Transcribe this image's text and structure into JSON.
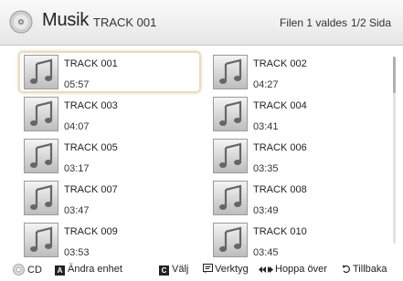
{
  "header": {
    "title": "Musik",
    "current_track": "TRACK 001",
    "selection_status": "Filen 1 valdes",
    "page_status": "1/2 Sida"
  },
  "tracks": [
    {
      "name": "TRACK 001",
      "duration": "05:57",
      "selected": true
    },
    {
      "name": "TRACK 002",
      "duration": "04:27",
      "selected": false
    },
    {
      "name": "TRACK 003",
      "duration": "04:07",
      "selected": false
    },
    {
      "name": "TRACK 004",
      "duration": "03:41",
      "selected": false
    },
    {
      "name": "TRACK 005",
      "duration": "03:17",
      "selected": false
    },
    {
      "name": "TRACK 006",
      "duration": "03:35",
      "selected": false
    },
    {
      "name": "TRACK 007",
      "duration": "03:47",
      "selected": false
    },
    {
      "name": "TRACK 008",
      "duration": "03:49",
      "selected": false
    },
    {
      "name": "TRACK 009",
      "duration": "03:53",
      "selected": false
    },
    {
      "name": "TRACK 010",
      "duration": "03:45",
      "selected": false
    }
  ],
  "footer": {
    "cd_label": "CD",
    "change_device_key": "A",
    "change_device_label": "Ändra enhet",
    "select_key": "C",
    "select_label": "Välj",
    "tools_label": "Verktyg",
    "skip_label": "Hoppa över",
    "back_label": "Tillbaka"
  },
  "icons": {
    "header": "disc-icon",
    "tile": "music-note-icon",
    "cd": "dpad-icon",
    "tools": "tools-icon",
    "skip": "skip-icon",
    "back": "return-icon"
  },
  "colors": {
    "selection_border": "#e8dcc0",
    "header_bg": "#eeeeee",
    "key_box": "#222222"
  }
}
